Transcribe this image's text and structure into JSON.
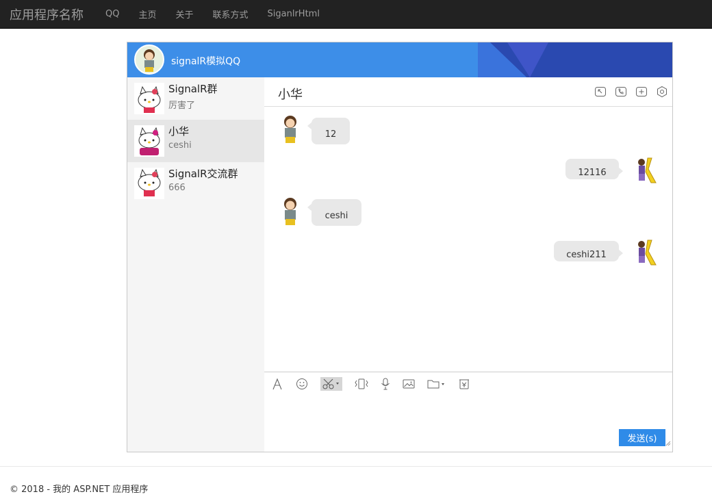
{
  "navbar": {
    "brand": "应用程序名称",
    "links": [
      "QQ",
      "主页",
      "关于",
      "联系方式",
      "SiganlrHtml"
    ]
  },
  "window": {
    "title": "signalR模拟QQ",
    "header_color": "#3d8ee8"
  },
  "contacts": [
    {
      "name": "SignalR群",
      "preview": "厉害了"
    },
    {
      "name": "小华",
      "preview": "ceshi",
      "active": true
    },
    {
      "name": "SignalR交流群",
      "preview": "666"
    }
  ],
  "chat": {
    "title": "小华",
    "header_icons": [
      "minimize-icon",
      "phone-icon",
      "add-icon",
      "settings-icon"
    ],
    "messages": [
      {
        "side": "left",
        "text": "12"
      },
      {
        "side": "right",
        "text": "12116"
      },
      {
        "side": "left",
        "text": "ceshi"
      },
      {
        "side": "right",
        "text": "ceshi211"
      }
    ],
    "input_tools": [
      "font-icon",
      "emoji-icon",
      "scissors-icon",
      "shake-icon",
      "microphone-icon",
      "image-icon",
      "folder-icon",
      "history-icon"
    ],
    "send_label": "发送(s)"
  },
  "footer": {
    "text": "© 2018 - 我的 ASP.NET 应用程序"
  },
  "colors": {
    "accent": "#2f8be8",
    "bubble": "#e8e8e8",
    "navbar": "#222222"
  }
}
